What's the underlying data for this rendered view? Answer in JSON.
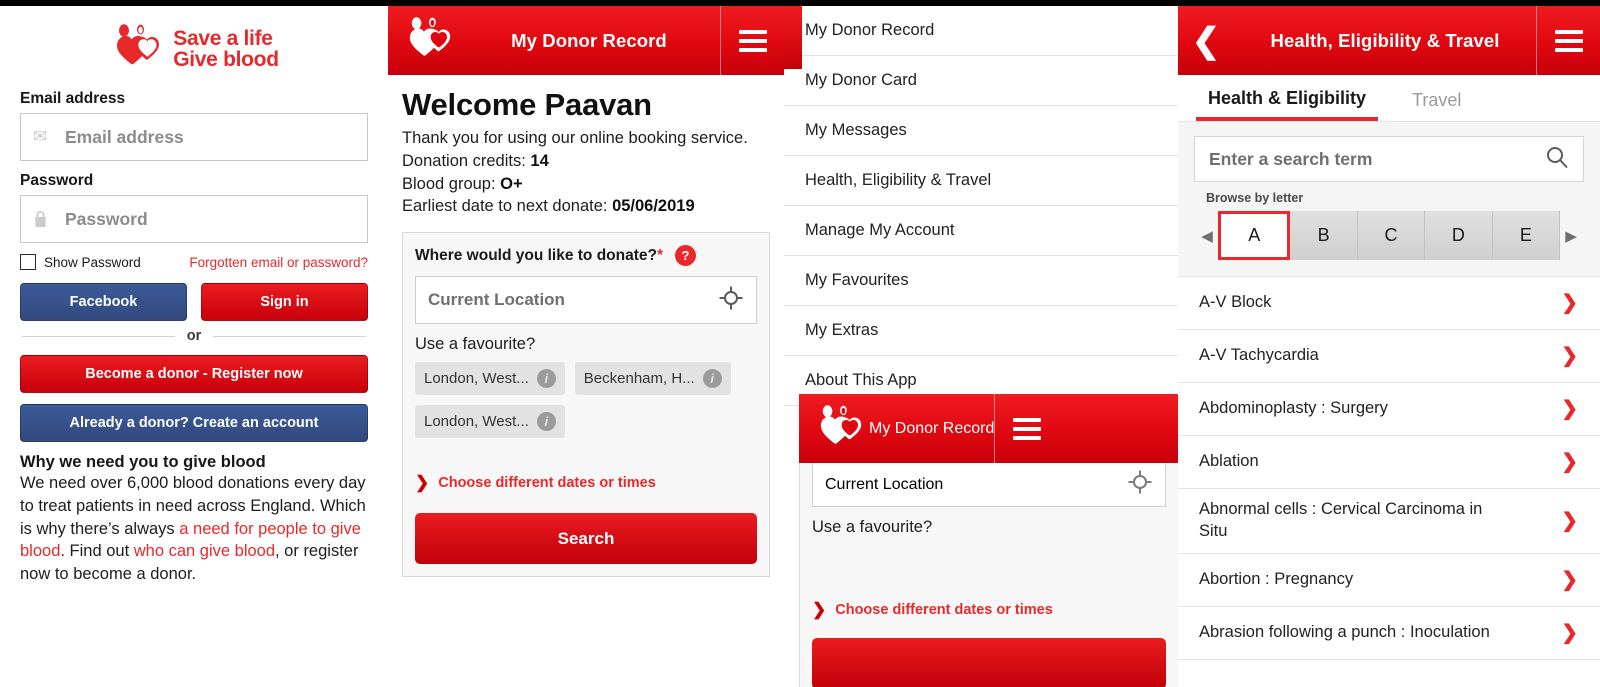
{
  "brand": {
    "accent_red": "#e8292b",
    "header_red": "#e00810",
    "facebook_blue": "#3c5a99"
  },
  "login": {
    "logo_line1": "Save a life",
    "logo_line2": "Give blood",
    "email_label": "Email address",
    "email_placeholder": "Email address",
    "email_icon": "envelope-icon",
    "password_label": "Password",
    "password_placeholder": "Password",
    "password_icon": "lock-icon",
    "show_password_label": "Show Password",
    "forgotten_link": "Forgotten email or password?",
    "facebook_button": "Facebook",
    "signin_button": "Sign in",
    "or_divider": "or",
    "register_button": "Become a donor - Register now",
    "create_account_button": "Already a donor? Create an account",
    "info_title": "Why we need you to give blood",
    "info_text_1": "We need over 6,000 blood donations every day to treat patients in need across England. Which is why there’s always ",
    "info_link_1": "a need for people to give blood",
    "info_text_2": ". Find out ",
    "info_link_2": "who can give blood",
    "info_text_3": ", or register now to become a donor."
  },
  "welcome": {
    "header_title": "My Donor Record",
    "heading": "Welcome Paavan",
    "thanks": "Thank you for using our online booking service.",
    "credits_label": "Donation credits: ",
    "credits_value": "14",
    "bloodgroup_label": "Blood group: ",
    "bloodgroup_value": "O+",
    "nextdate_label": "Earliest date to next donate: ",
    "nextdate_value": "05/06/2019",
    "card": {
      "question": "Where would you like to donate?",
      "required_mark": "*",
      "help_glyph": "?",
      "location_placeholder": "Current Location",
      "location_icon": "crosshair-icon",
      "favourite_label": "Use a favourite?",
      "favourites": [
        {
          "label": "London, West...",
          "info": "i"
        },
        {
          "label": "Beckenham, H...",
          "info": "i"
        },
        {
          "label": "London, West...",
          "info": "i"
        }
      ],
      "choose_dates": "Choose different dates or times",
      "search_button": "Search"
    }
  },
  "menu": {
    "items": [
      "My Donor Record",
      "My Donor Card",
      "My Messages",
      "Health, Eligibility & Travel",
      "Manage My Account",
      "My Favourites",
      "My Extras",
      "About This App"
    ],
    "overlay": {
      "header_title": "My Donor Record",
      "location_placeholder": "Current Location",
      "favourite_label": "Use a favourite?",
      "choose_dates": "Choose different dates or times"
    }
  },
  "health": {
    "header_title": "Health, Eligibility & Travel",
    "back_icon": "chevron-left-icon",
    "tab_active": "Health & Eligibility",
    "tab_inactive": "Travel",
    "search_placeholder": "Enter a search term",
    "search_icon": "search-icon",
    "browse_label": "Browse by letter",
    "letters": [
      "A",
      "B",
      "C",
      "D",
      "E"
    ],
    "selected_letter": "A",
    "prev_arrow": "◀",
    "next_arrow": "▶",
    "entries": [
      "A-V Block",
      "A-V Tachycardia",
      "Abdominoplasty : Surgery",
      "Ablation",
      "Abnormal cells : Cervical Carcinoma in Situ",
      "Abortion : Pregnancy",
      "Abrasion following a punch : Inoculation"
    ]
  }
}
